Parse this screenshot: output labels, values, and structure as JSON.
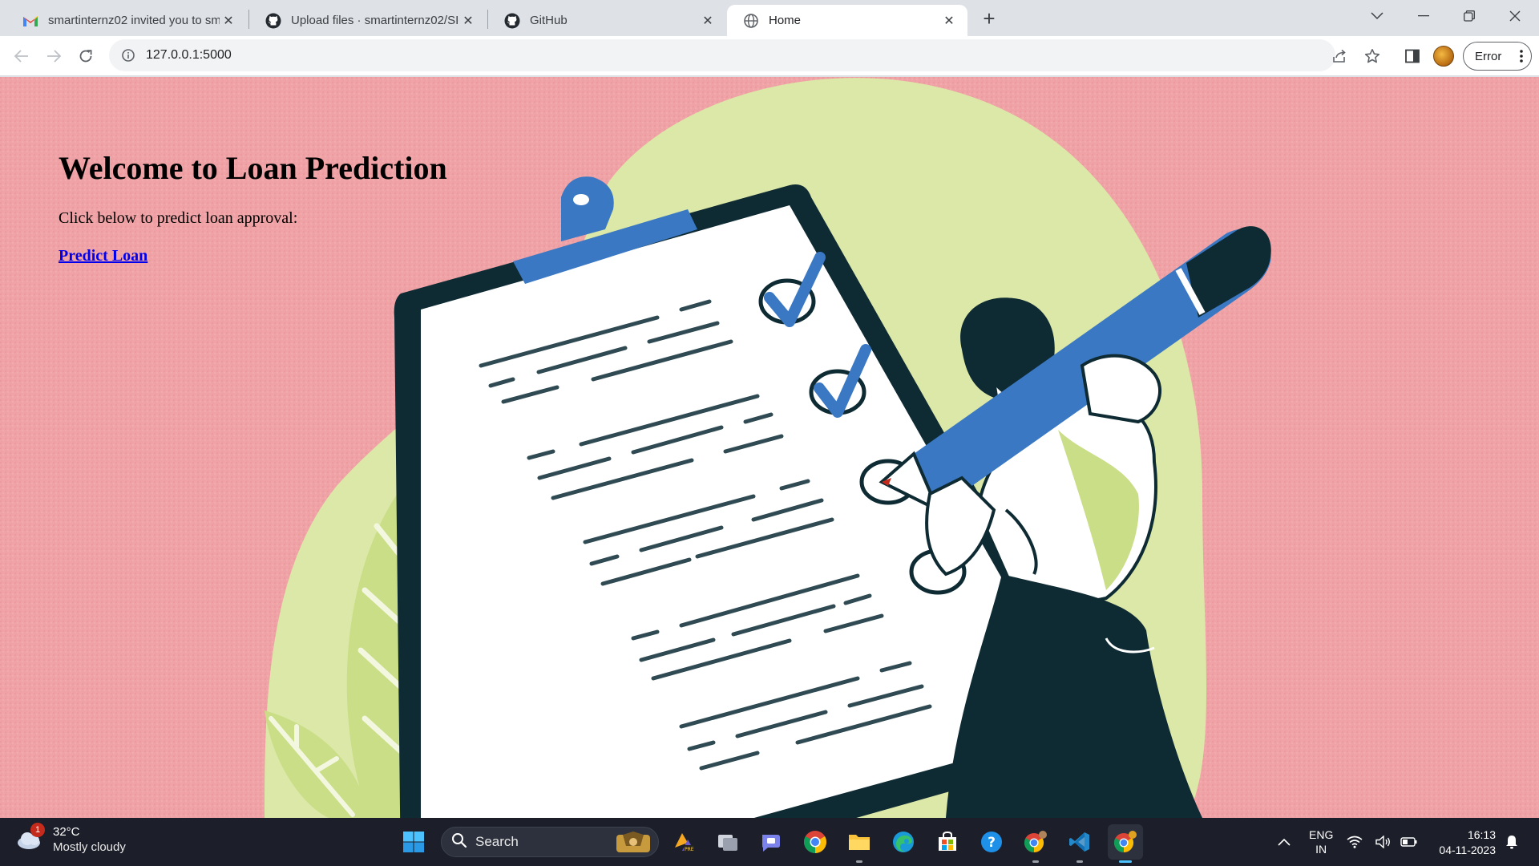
{
  "browser": {
    "tabs": [
      {
        "title": "smartinternz02 invited you to sm",
        "icon": "gmail-icon",
        "active": false
      },
      {
        "title": "Upload files · smartinternz02/SI-",
        "icon": "github-icon",
        "active": false
      },
      {
        "title": "GitHub",
        "icon": "github-icon",
        "active": false
      },
      {
        "title": "Home",
        "icon": "globe-icon",
        "active": true
      }
    ],
    "url": "127.0.0.1:5000",
    "profile_button_label": "Error"
  },
  "page": {
    "heading": "Welcome to Loan Prediction",
    "prompt": "Click below to predict loan approval:",
    "link_label": "Predict Loan"
  },
  "taskbar": {
    "weather": {
      "temperature": "32°C",
      "condition": "Mostly cloudy",
      "badge": "1"
    },
    "search_label": "Search",
    "language": {
      "line1": "ENG",
      "line2": "IN"
    },
    "clock": {
      "time": "16:13",
      "date": "04-11-2023"
    }
  },
  "colors": {
    "page_background": "#f0a3a6",
    "blob": "#dce8a8",
    "dark_navy": "#0e2a33",
    "accent_blue": "#3a78c3",
    "leaf_green": "#c9de86"
  }
}
